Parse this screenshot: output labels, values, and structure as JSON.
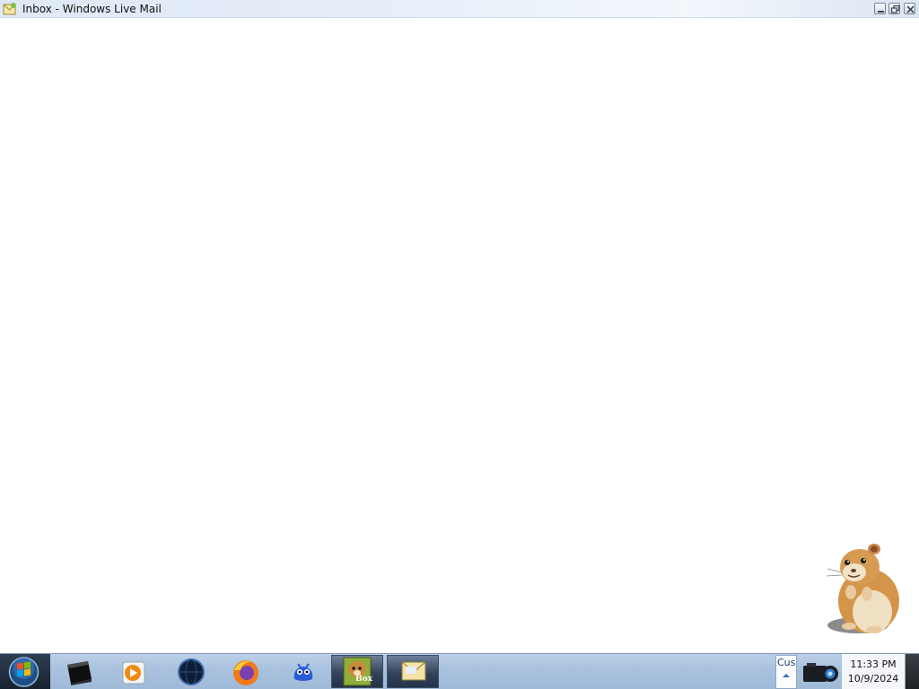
{
  "window": {
    "title": "Inbox - Windows Live Mail",
    "controls": [
      "minimize",
      "restore",
      "close"
    ]
  },
  "taskbar": {
    "start_button": "start-orb-icon",
    "pinned": [
      {
        "name": "command-prompt-icon"
      },
      {
        "name": "media-player-icon"
      },
      {
        "name": "globe-icon"
      },
      {
        "name": "firefox-icon"
      },
      {
        "name": "blue-mascot-icon"
      }
    ],
    "open_apps": [
      {
        "name": "box-game-icon",
        "label": "Box"
      },
      {
        "name": "windows-live-mail-icon"
      }
    ],
    "tray": {
      "text": "Cus",
      "camera_icon": "camera-icon"
    },
    "clock": {
      "time": "11:33 PM",
      "date": "10/9/2024"
    }
  },
  "desktop": {
    "mascot": "hamster-icon"
  },
  "colors": {
    "taskbar": "#a8c1de",
    "titlebar": "#e6eef9",
    "content": "#ffffff"
  }
}
